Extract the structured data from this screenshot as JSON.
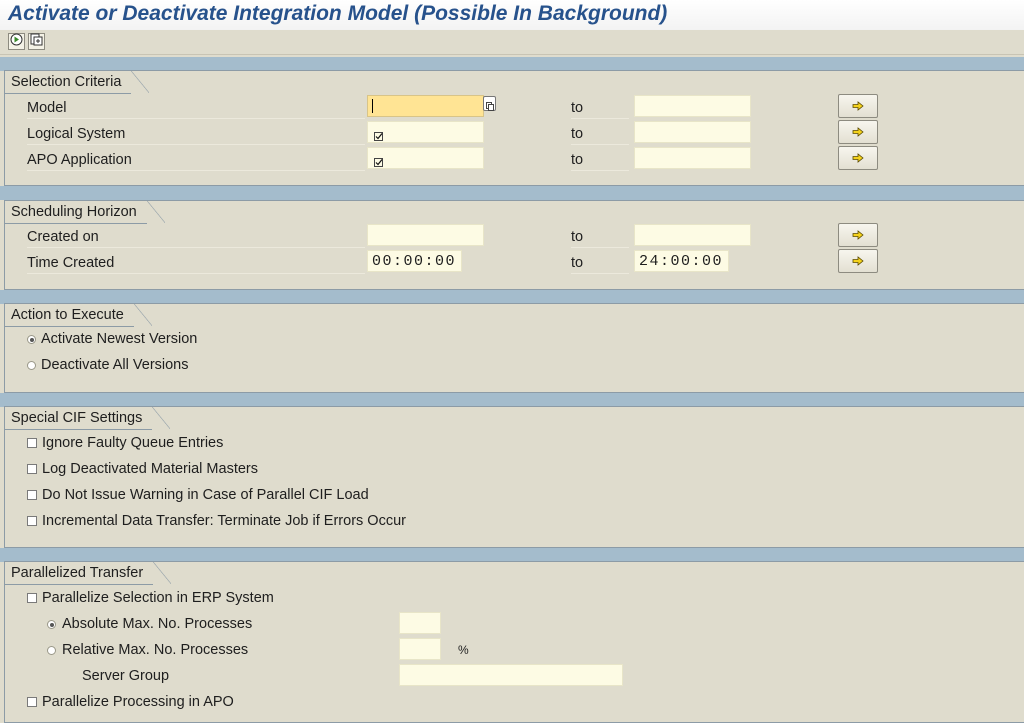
{
  "window": {
    "title": "Activate or Deactivate Integration Model (Possible In Background)"
  },
  "toolbar": {
    "buttons": [
      {
        "icon": "execute-icon"
      },
      {
        "icon": "variant-icon"
      }
    ]
  },
  "selection_criteria": {
    "title": "Selection Criteria",
    "rows": [
      {
        "label": "Model",
        "to": "to",
        "from_value": "",
        "to_value": ""
      },
      {
        "label": "Logical System",
        "to": "to",
        "from_value": "",
        "to_value": ""
      },
      {
        "label": "APO Application",
        "to": "to",
        "from_value": "",
        "to_value": ""
      }
    ]
  },
  "scheduling_horizon": {
    "title": "Scheduling Horizon",
    "rows": [
      {
        "label": "Created on",
        "to": "to",
        "from_value": "",
        "to_value": ""
      },
      {
        "label": "Time Created",
        "to": "to",
        "from_value": "00:00:00",
        "to_value": "24:00:00"
      }
    ]
  },
  "action": {
    "title": "Action to Execute",
    "options": [
      {
        "label": "Activate Newest Version",
        "selected": true
      },
      {
        "label": "Deactivate All Versions",
        "selected": false
      }
    ]
  },
  "cif_settings": {
    "title": "Special CIF Settings",
    "options": [
      {
        "label": "Ignore Faulty Queue Entries",
        "checked": false
      },
      {
        "label": "Log Deactivated Material Masters",
        "checked": false
      },
      {
        "label": "Do Not Issue Warning in Case of Parallel CIF Load",
        "checked": false
      },
      {
        "label": "Incremental Data Transfer: Terminate Job if Errors Occur",
        "checked": false
      }
    ]
  },
  "parallel": {
    "title": "Parallelized Transfer",
    "parallelize_erp": {
      "label": "Parallelize Selection in ERP System",
      "checked": false
    },
    "absolute": {
      "label": "Absolute Max. No. Processes",
      "selected": true,
      "value": ""
    },
    "relative": {
      "label": "Relative Max. No. Processes",
      "selected": false,
      "value": "",
      "unit": "%"
    },
    "server_group": {
      "label": "Server Group",
      "value": ""
    },
    "parallelize_apo": {
      "label": "Parallelize Processing in APO",
      "checked": false
    }
  }
}
